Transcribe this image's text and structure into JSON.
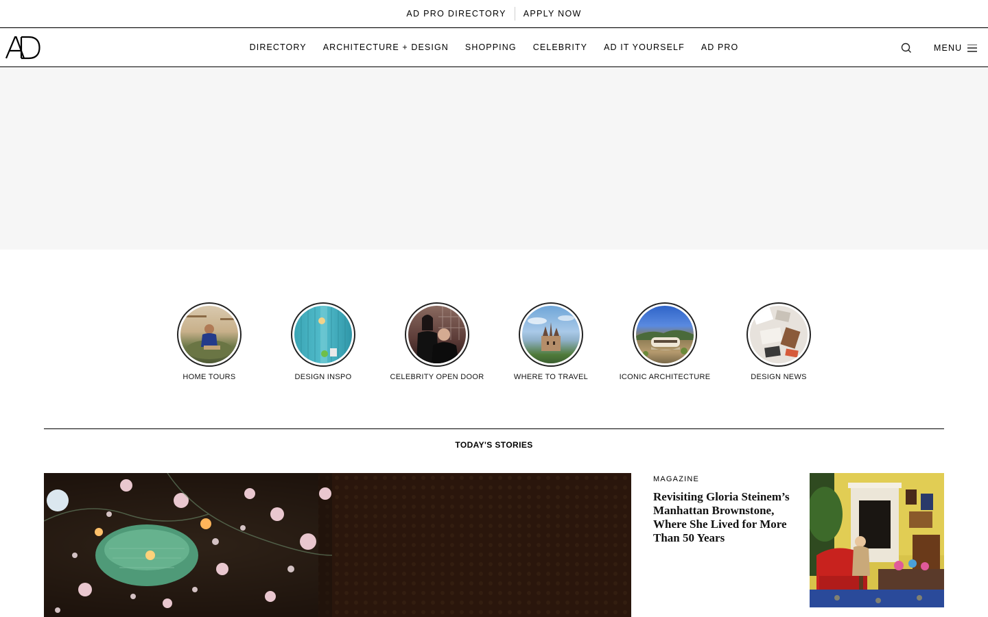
{
  "utility": {
    "directory_label": "AD PRO DIRECTORY",
    "apply_label": "APPLY NOW"
  },
  "nav": {
    "logo_text": "AD",
    "items": [
      {
        "label": "DIRECTORY"
      },
      {
        "label": "ARCHITECTURE + DESIGN"
      },
      {
        "label": "SHOPPING"
      },
      {
        "label": "CELEBRITY"
      },
      {
        "label": "AD IT YOURSELF"
      },
      {
        "label": "AD PRO"
      }
    ],
    "search_icon": "search-icon",
    "menu_label": "MENU",
    "menu_icon": "hamburger-icon"
  },
  "categories": [
    {
      "label": "HOME TOURS"
    },
    {
      "label": "DESIGN INSPO"
    },
    {
      "label": "CELEBRITY OPEN DOOR"
    },
    {
      "label": "WHERE TO TRAVEL"
    },
    {
      "label": "ICONIC ARCHITECTURE"
    },
    {
      "label": "DESIGN NEWS"
    }
  ],
  "stories": {
    "section_title": "TODAY'S STORIES",
    "side_story": {
      "kicker": "MAGAZINE",
      "headline": "Revisiting Gloria Steinem’s Manhattan Brownstone, Where She Lived for More Than 50 Years"
    }
  },
  "colors": {
    "text": "#000000",
    "ad_background": "#f6f6f6",
    "divider": "#000000"
  }
}
